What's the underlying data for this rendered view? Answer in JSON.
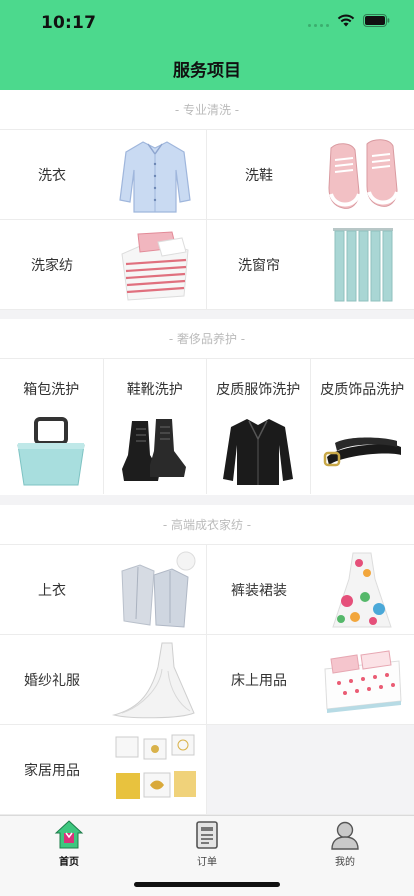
{
  "status": {
    "time": "10:17"
  },
  "header": {
    "title": "服务项目"
  },
  "sections": [
    {
      "title": "- 专业清洗 -",
      "items": [
        {
          "label": "洗衣",
          "icon": "shirt-icon"
        },
        {
          "label": "洗鞋",
          "icon": "sneaker-icon"
        },
        {
          "label": "洗家纺",
          "icon": "bedding-icon"
        },
        {
          "label": "洗窗帘",
          "icon": "curtain-icon"
        }
      ]
    },
    {
      "title": "- 奢侈品养护 -",
      "items": [
        {
          "label": "箱包洗护",
          "icon": "handbag-icon"
        },
        {
          "label": "鞋靴洗护",
          "icon": "boots-icon"
        },
        {
          "label": "皮质服饰洗护",
          "icon": "leather-jacket-icon"
        },
        {
          "label": "皮质饰品洗护",
          "icon": "belt-icon"
        }
      ]
    },
    {
      "title": "- 高端成衣家纺 -",
      "items": [
        {
          "label": "上衣",
          "icon": "tops-icon"
        },
        {
          "label": "裤装裙装",
          "icon": "dress-icon"
        },
        {
          "label": "婚纱礼服",
          "icon": "wedding-dress-icon"
        },
        {
          "label": "床上用品",
          "icon": "bed-icon"
        },
        {
          "label": "家居用品",
          "icon": "pillows-icon"
        }
      ]
    }
  ],
  "tabbar": [
    {
      "label": "首页",
      "icon": "home-icon",
      "active": true
    },
    {
      "label": "订单",
      "icon": "order-icon",
      "active": false
    },
    {
      "label": "我的",
      "icon": "profile-icon",
      "active": false
    }
  ],
  "colors": {
    "accent": "#4cd98d",
    "background": "#f3f3f5",
    "divider": "#ececec"
  }
}
